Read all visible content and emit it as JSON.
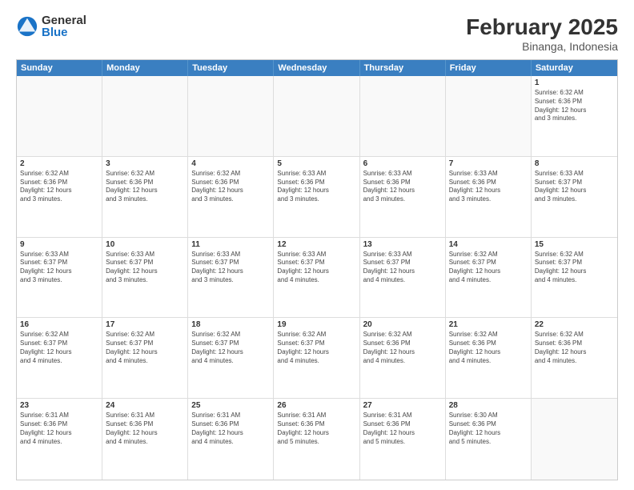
{
  "header": {
    "logo": {
      "general": "General",
      "blue": "Blue"
    },
    "title": "February 2025",
    "location": "Binanga, Indonesia"
  },
  "dayHeaders": [
    "Sunday",
    "Monday",
    "Tuesday",
    "Wednesday",
    "Thursday",
    "Friday",
    "Saturday"
  ],
  "weeks": [
    [
      {
        "date": "",
        "info": ""
      },
      {
        "date": "",
        "info": ""
      },
      {
        "date": "",
        "info": ""
      },
      {
        "date": "",
        "info": ""
      },
      {
        "date": "",
        "info": ""
      },
      {
        "date": "",
        "info": ""
      },
      {
        "date": "1",
        "info": "Sunrise: 6:32 AM\nSunset: 6:36 PM\nDaylight: 12 hours\nand 3 minutes."
      }
    ],
    [
      {
        "date": "2",
        "info": "Sunrise: 6:32 AM\nSunset: 6:36 PM\nDaylight: 12 hours\nand 3 minutes."
      },
      {
        "date": "3",
        "info": "Sunrise: 6:32 AM\nSunset: 6:36 PM\nDaylight: 12 hours\nand 3 minutes."
      },
      {
        "date": "4",
        "info": "Sunrise: 6:32 AM\nSunset: 6:36 PM\nDaylight: 12 hours\nand 3 minutes."
      },
      {
        "date": "5",
        "info": "Sunrise: 6:33 AM\nSunset: 6:36 PM\nDaylight: 12 hours\nand 3 minutes."
      },
      {
        "date": "6",
        "info": "Sunrise: 6:33 AM\nSunset: 6:36 PM\nDaylight: 12 hours\nand 3 minutes."
      },
      {
        "date": "7",
        "info": "Sunrise: 6:33 AM\nSunset: 6:36 PM\nDaylight: 12 hours\nand 3 minutes."
      },
      {
        "date": "8",
        "info": "Sunrise: 6:33 AM\nSunset: 6:37 PM\nDaylight: 12 hours\nand 3 minutes."
      }
    ],
    [
      {
        "date": "9",
        "info": "Sunrise: 6:33 AM\nSunset: 6:37 PM\nDaylight: 12 hours\nand 3 minutes."
      },
      {
        "date": "10",
        "info": "Sunrise: 6:33 AM\nSunset: 6:37 PM\nDaylight: 12 hours\nand 3 minutes."
      },
      {
        "date": "11",
        "info": "Sunrise: 6:33 AM\nSunset: 6:37 PM\nDaylight: 12 hours\nand 3 minutes."
      },
      {
        "date": "12",
        "info": "Sunrise: 6:33 AM\nSunset: 6:37 PM\nDaylight: 12 hours\nand 4 minutes."
      },
      {
        "date": "13",
        "info": "Sunrise: 6:33 AM\nSunset: 6:37 PM\nDaylight: 12 hours\nand 4 minutes."
      },
      {
        "date": "14",
        "info": "Sunrise: 6:32 AM\nSunset: 6:37 PM\nDaylight: 12 hours\nand 4 minutes."
      },
      {
        "date": "15",
        "info": "Sunrise: 6:32 AM\nSunset: 6:37 PM\nDaylight: 12 hours\nand 4 minutes."
      }
    ],
    [
      {
        "date": "16",
        "info": "Sunrise: 6:32 AM\nSunset: 6:37 PM\nDaylight: 12 hours\nand 4 minutes."
      },
      {
        "date": "17",
        "info": "Sunrise: 6:32 AM\nSunset: 6:37 PM\nDaylight: 12 hours\nand 4 minutes."
      },
      {
        "date": "18",
        "info": "Sunrise: 6:32 AM\nSunset: 6:37 PM\nDaylight: 12 hours\nand 4 minutes."
      },
      {
        "date": "19",
        "info": "Sunrise: 6:32 AM\nSunset: 6:37 PM\nDaylight: 12 hours\nand 4 minutes."
      },
      {
        "date": "20",
        "info": "Sunrise: 6:32 AM\nSunset: 6:36 PM\nDaylight: 12 hours\nand 4 minutes."
      },
      {
        "date": "21",
        "info": "Sunrise: 6:32 AM\nSunset: 6:36 PM\nDaylight: 12 hours\nand 4 minutes."
      },
      {
        "date": "22",
        "info": "Sunrise: 6:32 AM\nSunset: 6:36 PM\nDaylight: 12 hours\nand 4 minutes."
      }
    ],
    [
      {
        "date": "23",
        "info": "Sunrise: 6:31 AM\nSunset: 6:36 PM\nDaylight: 12 hours\nand 4 minutes."
      },
      {
        "date": "24",
        "info": "Sunrise: 6:31 AM\nSunset: 6:36 PM\nDaylight: 12 hours\nand 4 minutes."
      },
      {
        "date": "25",
        "info": "Sunrise: 6:31 AM\nSunset: 6:36 PM\nDaylight: 12 hours\nand 4 minutes."
      },
      {
        "date": "26",
        "info": "Sunrise: 6:31 AM\nSunset: 6:36 PM\nDaylight: 12 hours\nand 5 minutes."
      },
      {
        "date": "27",
        "info": "Sunrise: 6:31 AM\nSunset: 6:36 PM\nDaylight: 12 hours\nand 5 minutes."
      },
      {
        "date": "28",
        "info": "Sunrise: 6:30 AM\nSunset: 6:36 PM\nDaylight: 12 hours\nand 5 minutes."
      },
      {
        "date": "",
        "info": ""
      }
    ]
  ]
}
